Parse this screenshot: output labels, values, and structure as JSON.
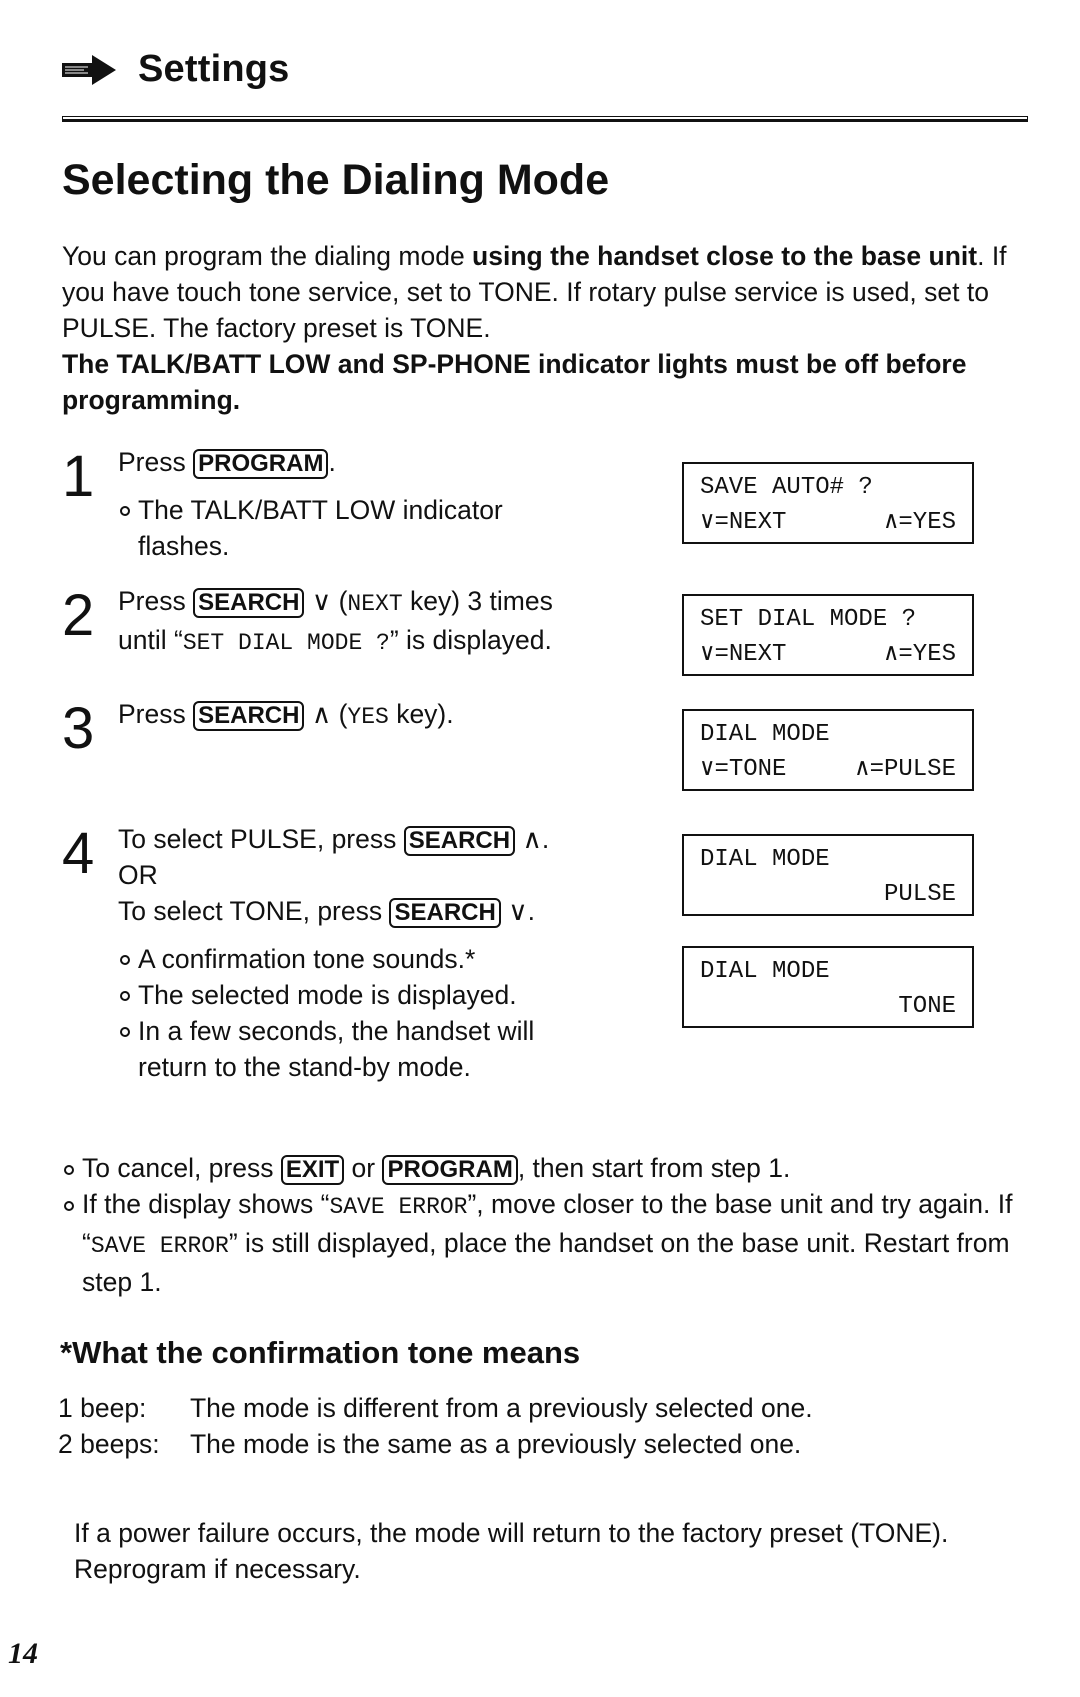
{
  "section": {
    "icon": "arrow-right-icon",
    "title": "Settings"
  },
  "page_title": "Selecting the Dialing Mode",
  "intro": {
    "p1_a": "You can program the dialing mode ",
    "p1_bold": "using the handset close to the base unit",
    "p1_b": ". If you have touch tone service, set to TONE. If rotary pulse service is used, set to PULSE. The factory preset is TONE.",
    "warning": "The TALK/BATT LOW and SP-PHONE indicator lights must be off before programming."
  },
  "steps": [
    {
      "number": "1",
      "text_a": "Press ",
      "key": "PROGRAM",
      "text_b": ".",
      "bullets": [
        "The TALK/BATT LOW indicator flashes."
      ]
    },
    {
      "number": "2",
      "text_a": "Press ",
      "key": "SEARCH",
      "text_b": " ∨ (",
      "mono": "NEXT",
      "text_c": " key) 3 times",
      "line2_a": "until “",
      "line2_mono": "SET DIAL MODE ?",
      "line2_b": "” is displayed."
    },
    {
      "number": "3",
      "text_a": "Press ",
      "key": "SEARCH",
      "text_b": " ∧ (",
      "mono": "YES",
      "text_c": " key)."
    },
    {
      "number": "4",
      "line1_a": "To select PULSE, press ",
      "line1_key": "SEARCH",
      "line1_b": " ∧.",
      "or": "OR",
      "line3_a": "To select TONE, press ",
      "line3_key": "SEARCH",
      "line3_b": " ∨.",
      "bullets": [
        "A confirmation tone sounds.*",
        "The selected mode is displayed.",
        "In a few seconds, the handset will return to the stand-by mode."
      ]
    }
  ],
  "displays": [
    {
      "line1": "SAVE AUTO# ?",
      "line2_left": "∨=NEXT",
      "line2_right": "∧=YES"
    },
    {
      "line1": "SET DIAL MODE ?",
      "line2_left": "∨=NEXT",
      "line2_right": "∧=YES"
    },
    {
      "line1": "DIAL MODE",
      "line2_left": "∨=TONE",
      "line2_right": "∧=PULSE"
    },
    {
      "line1": "DIAL MODE",
      "line2_right": "PULSE"
    },
    {
      "line1": "DIAL MODE",
      "line2_right": "TONE"
    }
  ],
  "notes": {
    "cancel_a": "To cancel, press ",
    "cancel_key1": "EXIT",
    "cancel_b": " or ",
    "cancel_key2": "PROGRAM",
    "cancel_c": ", then start from step 1.",
    "error_a": "If the display shows “",
    "error_mono1": "SAVE ERROR",
    "error_b": "”, move closer to the base unit and try again. If “",
    "error_mono2": "SAVE ERROR",
    "error_c": "” is still displayed, place the handset on the base unit. Restart from step 1."
  },
  "confirmation": {
    "title": "*What the confirmation tone means",
    "rows": [
      {
        "label": "1 beep:",
        "text": "The mode is different from a previously selected one."
      },
      {
        "label": "2 beeps:",
        "text": "The mode is the same as a previously selected one."
      }
    ]
  },
  "footnote": "If a power failure occurs, the mode will return to the factory preset (TONE). Reprogram if necessary.",
  "page_number": "14"
}
